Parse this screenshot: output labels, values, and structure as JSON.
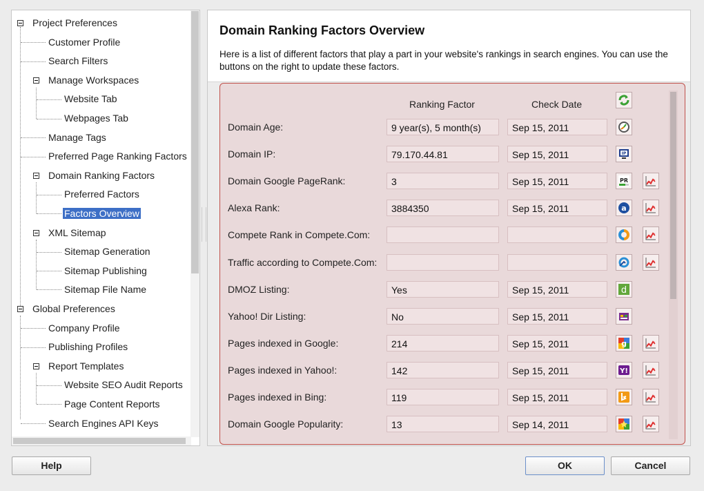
{
  "tree": {
    "items": [
      {
        "label": "Project Preferences"
      },
      {
        "label": "Customer Profile"
      },
      {
        "label": "Search Filters"
      },
      {
        "label": "Manage Workspaces"
      },
      {
        "label": "Website Tab"
      },
      {
        "label": "Webpages Tab"
      },
      {
        "label": "Manage Tags"
      },
      {
        "label": "Preferred Page Ranking Factors"
      },
      {
        "label": "Domain Ranking Factors"
      },
      {
        "label": "Preferred Factors"
      },
      {
        "label": "Factors Overview"
      },
      {
        "label": "XML Sitemap"
      },
      {
        "label": "Sitemap Generation"
      },
      {
        "label": "Sitemap Publishing"
      },
      {
        "label": "Sitemap File Name"
      },
      {
        "label": "Global Preferences"
      },
      {
        "label": "Company Profile"
      },
      {
        "label": "Publishing Profiles"
      },
      {
        "label": "Report Templates"
      },
      {
        "label": "Website SEO Audit Reports"
      },
      {
        "label": "Page Content Reports"
      },
      {
        "label": "Search Engines API Keys"
      }
    ]
  },
  "header": {
    "title": "Domain Ranking Factors Overview",
    "description": "Here is a list of different factors that play a part in your website's rankings in search engines. You can use the buttons on the right to update these factors."
  },
  "table": {
    "col_factor": "Ranking Factor",
    "col_date": "Check Date",
    "rows": [
      {
        "label": "Domain Age:",
        "value": "9 year(s), 5 month(s)",
        "date": "Sep 15, 2011",
        "icon": "domain-age-icon",
        "graph": false
      },
      {
        "label": "Domain IP:",
        "value": "79.170.44.81",
        "date": "Sep 15, 2011",
        "icon": "ip-icon",
        "graph": false
      },
      {
        "label": "Domain Google PageRank:",
        "value": "3",
        "date": "Sep 15, 2011",
        "icon": "pagerank-icon",
        "graph": true
      },
      {
        "label": "Alexa Rank:",
        "value": "3884350",
        "date": "Sep 15, 2011",
        "icon": "alexa-icon",
        "graph": true
      },
      {
        "label": "Compete Rank in Compete.Com:",
        "value": "",
        "date": "",
        "icon": "compete-icon",
        "graph": true
      },
      {
        "label": "Traffic according to Compete.Com:",
        "value": "",
        "date": "",
        "icon": "traffic-icon",
        "graph": true
      },
      {
        "label": "DMOZ Listing:",
        "value": "Yes",
        "date": "Sep 15, 2011",
        "icon": "dmoz-icon",
        "graph": false
      },
      {
        "label": "Yahoo! Dir Listing:",
        "value": "No",
        "date": "Sep 15, 2011",
        "icon": "yahoo-dir-icon",
        "graph": false
      },
      {
        "label": "Pages indexed in Google:",
        "value": "214",
        "date": "Sep 15, 2011",
        "icon": "google-icon",
        "graph": true
      },
      {
        "label": "Pages indexed in Yahoo!:",
        "value": "142",
        "date": "Sep 15, 2011",
        "icon": "yahoo-icon",
        "graph": true
      },
      {
        "label": "Pages indexed in Bing:",
        "value": "119",
        "date": "Sep 15, 2011",
        "icon": "bing-icon",
        "graph": true
      },
      {
        "label": "Domain Google Popularity:",
        "value": "13",
        "date": "Sep 14, 2011",
        "icon": "google-popularity-icon",
        "graph": true
      }
    ]
  },
  "buttons": {
    "help": "Help",
    "ok": "OK",
    "cancel": "Cancel"
  },
  "colors": {
    "selection": "#3d6fc6",
    "panel_border": "#c0504a",
    "panel_bg": "#e9d9da"
  }
}
